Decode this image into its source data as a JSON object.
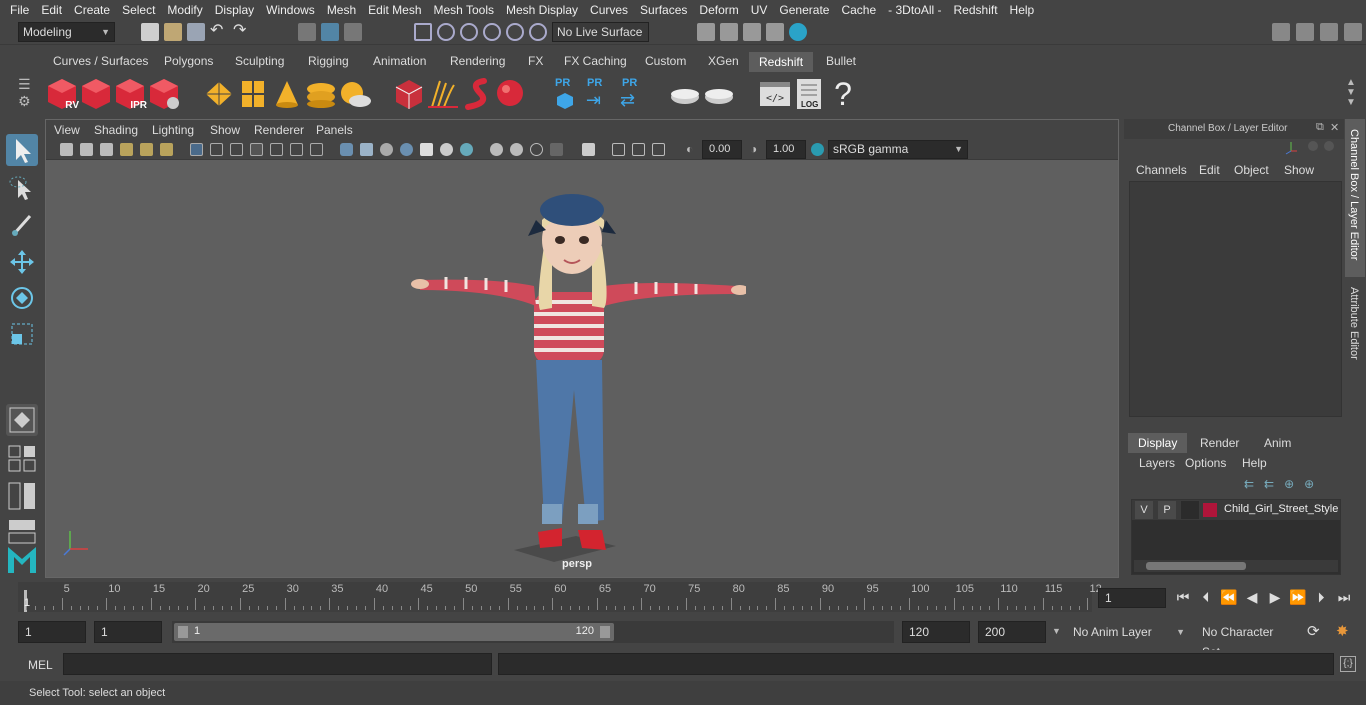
{
  "menubar": {
    "items": [
      "File",
      "Edit",
      "Create",
      "Select",
      "Modify",
      "Display",
      "Windows",
      "Mesh",
      "Edit Mesh",
      "Mesh Tools",
      "Mesh Display",
      "Curves",
      "Surfaces",
      "Deform",
      "UV",
      "Generate",
      "Cache",
      "- 3DtoAll -",
      "Redshift",
      "Help"
    ]
  },
  "statusline": {
    "mode": "Modeling",
    "live_surface": "No Live Surface"
  },
  "shelf": {
    "tabs": [
      "Curves / Surfaces",
      "Polygons",
      "Sculpting",
      "Rigging",
      "Animation",
      "Rendering",
      "FX",
      "FX Caching",
      "Custom",
      "XGen",
      "Redshift",
      "Bullet"
    ],
    "active_tab": "Redshift",
    "rv_label": "RV",
    "ipr_label": "IPR",
    "pr_label": "PR",
    "log_label": "LOG",
    "help_glyph": "?"
  },
  "viewport": {
    "menus": [
      "View",
      "Shading",
      "Lighting",
      "Show",
      "Renderer",
      "Panels"
    ],
    "exposure": "0.00",
    "gamma": "1.00",
    "color_space": "sRGB gamma",
    "camera_label": "persp"
  },
  "channel_box": {
    "title": "Channel Box / Layer Editor",
    "menus": [
      "Channels",
      "Edit",
      "Object",
      "Show"
    ],
    "layer_tabs": [
      "Display",
      "Render",
      "Anim"
    ],
    "active_layer_tab": "Display",
    "layer_menus": [
      "Layers",
      "Options",
      "Help"
    ],
    "layer": {
      "v": "V",
      "p": "P",
      "name": "Child_Girl_Street_Style",
      "color": "#b0153a"
    }
  },
  "side_tabs": [
    "Channel Box / Layer Editor",
    "Attribute Editor"
  ],
  "timeline": {
    "ticks": [
      "5",
      "10",
      "15",
      "20",
      "25",
      "30",
      "35",
      "40",
      "45",
      "50",
      "55",
      "60",
      "65",
      "70",
      "75",
      "80",
      "85",
      "90",
      "95",
      "100",
      "105",
      "110",
      "115",
      "12"
    ],
    "current_frame": "1",
    "frame_field": "1"
  },
  "range": {
    "start": "1",
    "playback_start": "1",
    "slider_start": "1",
    "slider_end": "120",
    "playback_end": "120",
    "end": "200",
    "anim_layer": "No Anim Layer",
    "character_set": "No Character Set"
  },
  "command_line": {
    "lang": "MEL"
  },
  "help_line": {
    "text": "Select Tool: select an object"
  },
  "colors": {
    "accent": "#5d5d5d",
    "redshift_red": "#d8293a",
    "selected_tool": "#5285a6"
  }
}
